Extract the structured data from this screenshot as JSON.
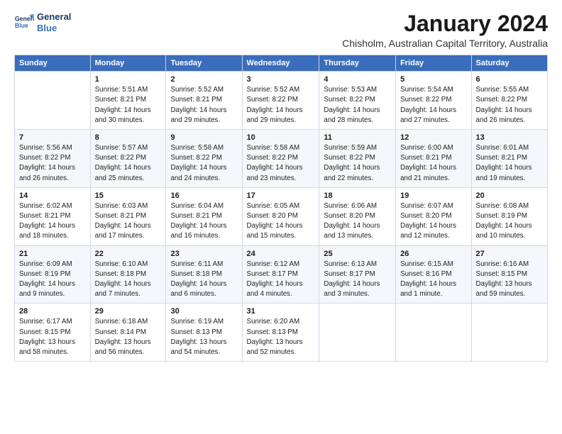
{
  "logo": {
    "line1": "General",
    "line2": "Blue"
  },
  "title": "January 2024",
  "subtitle": "Chisholm, Australian Capital Territory, Australia",
  "header": {
    "colors": {
      "bg": "#3a6dbb"
    }
  },
  "days_of_week": [
    "Sunday",
    "Monday",
    "Tuesday",
    "Wednesday",
    "Thursday",
    "Friday",
    "Saturday"
  ],
  "weeks": [
    [
      {
        "day": "",
        "detail": ""
      },
      {
        "day": "1",
        "detail": "Sunrise: 5:51 AM\nSunset: 8:21 PM\nDaylight: 14 hours\nand 30 minutes."
      },
      {
        "day": "2",
        "detail": "Sunrise: 5:52 AM\nSunset: 8:21 PM\nDaylight: 14 hours\nand 29 minutes."
      },
      {
        "day": "3",
        "detail": "Sunrise: 5:52 AM\nSunset: 8:22 PM\nDaylight: 14 hours\nand 29 minutes."
      },
      {
        "day": "4",
        "detail": "Sunrise: 5:53 AM\nSunset: 8:22 PM\nDaylight: 14 hours\nand 28 minutes."
      },
      {
        "day": "5",
        "detail": "Sunrise: 5:54 AM\nSunset: 8:22 PM\nDaylight: 14 hours\nand 27 minutes."
      },
      {
        "day": "6",
        "detail": "Sunrise: 5:55 AM\nSunset: 8:22 PM\nDaylight: 14 hours\nand 26 minutes."
      }
    ],
    [
      {
        "day": "7",
        "detail": "Sunrise: 5:56 AM\nSunset: 8:22 PM\nDaylight: 14 hours\nand 26 minutes."
      },
      {
        "day": "8",
        "detail": "Sunrise: 5:57 AM\nSunset: 8:22 PM\nDaylight: 14 hours\nand 25 minutes."
      },
      {
        "day": "9",
        "detail": "Sunrise: 5:58 AM\nSunset: 8:22 PM\nDaylight: 14 hours\nand 24 minutes."
      },
      {
        "day": "10",
        "detail": "Sunrise: 5:58 AM\nSunset: 8:22 PM\nDaylight: 14 hours\nand 23 minutes."
      },
      {
        "day": "11",
        "detail": "Sunrise: 5:59 AM\nSunset: 8:22 PM\nDaylight: 14 hours\nand 22 minutes."
      },
      {
        "day": "12",
        "detail": "Sunrise: 6:00 AM\nSunset: 8:21 PM\nDaylight: 14 hours\nand 21 minutes."
      },
      {
        "day": "13",
        "detail": "Sunrise: 6:01 AM\nSunset: 8:21 PM\nDaylight: 14 hours\nand 19 minutes."
      }
    ],
    [
      {
        "day": "14",
        "detail": "Sunrise: 6:02 AM\nSunset: 8:21 PM\nDaylight: 14 hours\nand 18 minutes."
      },
      {
        "day": "15",
        "detail": "Sunrise: 6:03 AM\nSunset: 8:21 PM\nDaylight: 14 hours\nand 17 minutes."
      },
      {
        "day": "16",
        "detail": "Sunrise: 6:04 AM\nSunset: 8:21 PM\nDaylight: 14 hours\nand 16 minutes."
      },
      {
        "day": "17",
        "detail": "Sunrise: 6:05 AM\nSunset: 8:20 PM\nDaylight: 14 hours\nand 15 minutes."
      },
      {
        "day": "18",
        "detail": "Sunrise: 6:06 AM\nSunset: 8:20 PM\nDaylight: 14 hours\nand 13 minutes."
      },
      {
        "day": "19",
        "detail": "Sunrise: 6:07 AM\nSunset: 8:20 PM\nDaylight: 14 hours\nand 12 minutes."
      },
      {
        "day": "20",
        "detail": "Sunrise: 6:08 AM\nSunset: 8:19 PM\nDaylight: 14 hours\nand 10 minutes."
      }
    ],
    [
      {
        "day": "21",
        "detail": "Sunrise: 6:09 AM\nSunset: 8:19 PM\nDaylight: 14 hours\nand 9 minutes."
      },
      {
        "day": "22",
        "detail": "Sunrise: 6:10 AM\nSunset: 8:18 PM\nDaylight: 14 hours\nand 7 minutes."
      },
      {
        "day": "23",
        "detail": "Sunrise: 6:11 AM\nSunset: 8:18 PM\nDaylight: 14 hours\nand 6 minutes."
      },
      {
        "day": "24",
        "detail": "Sunrise: 6:12 AM\nSunset: 8:17 PM\nDaylight: 14 hours\nand 4 minutes."
      },
      {
        "day": "25",
        "detail": "Sunrise: 6:13 AM\nSunset: 8:17 PM\nDaylight: 14 hours\nand 3 minutes."
      },
      {
        "day": "26",
        "detail": "Sunrise: 6:15 AM\nSunset: 8:16 PM\nDaylight: 14 hours\nand 1 minute."
      },
      {
        "day": "27",
        "detail": "Sunrise: 6:16 AM\nSunset: 8:15 PM\nDaylight: 13 hours\nand 59 minutes."
      }
    ],
    [
      {
        "day": "28",
        "detail": "Sunrise: 6:17 AM\nSunset: 8:15 PM\nDaylight: 13 hours\nand 58 minutes."
      },
      {
        "day": "29",
        "detail": "Sunrise: 6:18 AM\nSunset: 8:14 PM\nDaylight: 13 hours\nand 56 minutes."
      },
      {
        "day": "30",
        "detail": "Sunrise: 6:19 AM\nSunset: 8:13 PM\nDaylight: 13 hours\nand 54 minutes."
      },
      {
        "day": "31",
        "detail": "Sunrise: 6:20 AM\nSunset: 8:13 PM\nDaylight: 13 hours\nand 52 minutes."
      },
      {
        "day": "",
        "detail": ""
      },
      {
        "day": "",
        "detail": ""
      },
      {
        "day": "",
        "detail": ""
      }
    ]
  ]
}
